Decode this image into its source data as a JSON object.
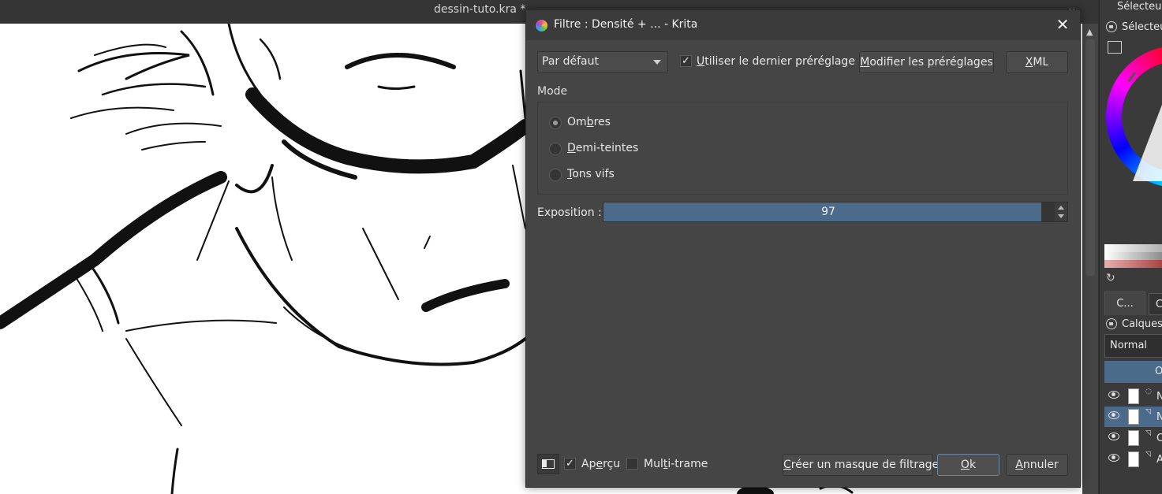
{
  "main_window": {
    "document_title": "dessin-tuto.kra *"
  },
  "dialog": {
    "title": "Filtre : Densité + ... - Krita",
    "preset": {
      "selected": "Par défaut",
      "use_last_label": "Utiliser le dernier préréglage",
      "use_last_checked": true,
      "edit_presets_button": "Modifier les préréglages",
      "xml_button": "XML"
    },
    "mode": {
      "title": "Mode",
      "options": [
        {
          "label": "Ombres",
          "checked": true
        },
        {
          "label": "Demi-teintes",
          "checked": false
        },
        {
          "label": "Tons vifs",
          "checked": false
        }
      ]
    },
    "exposure": {
      "label": "Exposition :",
      "value": "97",
      "fraction": 0.97
    },
    "footer": {
      "preview_label": "Aperçu",
      "preview_checked": true,
      "multiframe_label": "Multi-trame",
      "multiframe_checked": false,
      "create_mask_button": "Créer un masque de filtrage",
      "ok_button": "Ok",
      "cancel_button": "Annuler"
    }
  },
  "docker": {
    "selector_header": "Sélecteur",
    "selector_title": "Sélecteu",
    "tab_label": "C...",
    "tab2_label": "C",
    "layers_title": "Calques",
    "blend_mode": "Normal",
    "opacity_partial": "O",
    "layers": [
      {
        "name": "N",
        "active": false
      },
      {
        "name": "N",
        "active": true
      },
      {
        "name": "C",
        "active": false
      },
      {
        "name": "A",
        "active": false
      }
    ]
  },
  "colors": {
    "accent": "#4c6a8a",
    "dialog_bg": "#454545",
    "panel_bg": "#3a3a3a"
  },
  "icons": [
    "krita-app-icon",
    "close-icon",
    "chevron-down-icon",
    "lock-icon",
    "refresh-icon",
    "eye-icon",
    "preview-icon"
  ]
}
